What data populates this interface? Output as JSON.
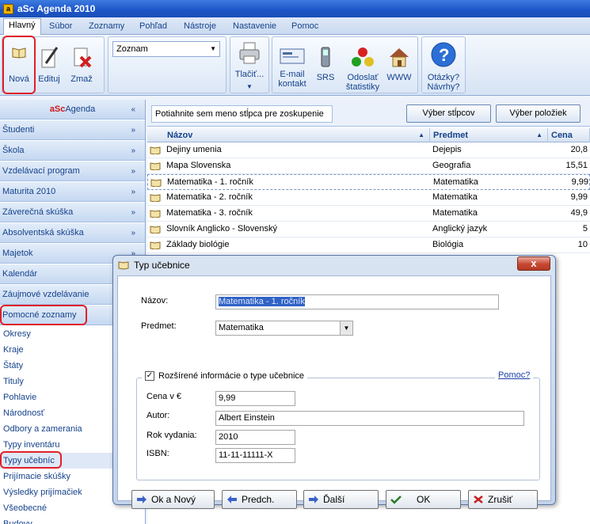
{
  "app": {
    "title": "aSc Agenda 2010"
  },
  "menu": [
    "Hlavný",
    "Súbor",
    "Zoznamy",
    "Pohľad",
    "Nástroje",
    "Nastavenie",
    "Pomoc"
  ],
  "ribbon": {
    "nova": "Nová",
    "edituj": "Edituj",
    "zmaz": "Zmaž",
    "combo": "Zoznam",
    "tlacit": "Tlačiť...",
    "email": "E-mail",
    "kontakt": "kontakt",
    "srs": "SRS",
    "odoslat": "Odoslať",
    "statistiky": "štatistiky",
    "www": "WWW",
    "otazky": "Otázky?",
    "navrhy": "Návrhy?"
  },
  "sidebar": {
    "brand_prefix": "aSc",
    "brand_suffix": "Agenda",
    "sections": [
      "Študenti",
      "Škola",
      "Vzdelávací program",
      "Maturita 2010",
      "Záverečná skúška",
      "Absolventská skúška",
      "Majetok",
      "Kalendár",
      "Záujmové vzdelávanie",
      "Pomocné zoznamy"
    ],
    "items": [
      "Okresy",
      "Kraje",
      "Štáty",
      "Tituly",
      "Pohlavie",
      "Národnosť",
      "Odbory a zamerania",
      "Typy inventáru",
      "Typy učebníc",
      "Prijímacie skúšky",
      "Výsledky prijímačiek",
      "Všeobecné",
      "Budovy"
    ],
    "chev": "»"
  },
  "grid": {
    "group_hint": "Potiahnite sem meno stĺpca pre zoskupenie",
    "btn_columns": "Výber stĺpcov",
    "btn_items": "Výber položiek",
    "col_name": "Názov",
    "col_subject": "Predmet",
    "col_price": "Cena",
    "sort": "▲",
    "rows": [
      {
        "name": "Dejiny umenia",
        "subject": "Dejepis",
        "price": "20,8"
      },
      {
        "name": "Mapa Slovenska",
        "subject": "Geografia",
        "price": "15,51"
      },
      {
        "name": "Matematika - 1. ročník",
        "subject": "Matematika",
        "price": "9,99"
      },
      {
        "name": "Matematika - 2. ročník",
        "subject": "Matematika",
        "price": "9,99"
      },
      {
        "name": "Matematika - 3. ročník",
        "subject": "Matematika",
        "price": "49,9"
      },
      {
        "name": "Slovník Anglicko - Slovenský",
        "subject": "Anglický jazyk",
        "price": "5"
      },
      {
        "name": "Základy biológie",
        "subject": "Biológia",
        "price": "10"
      }
    ]
  },
  "dialog": {
    "title": "Typ učebnice",
    "close": "x",
    "name_label": "Názov:",
    "name_value": "Matematika - 1. ročník",
    "subject_label": "Predmet:",
    "subject_value": "Matematika",
    "extended_label": "Rozšírené informácie o type učebnice",
    "help": "Pomoc?",
    "price_label": "Cena v €",
    "price_value": "9,99",
    "author_label": "Autor:",
    "author_value": "Albert Einstein",
    "year_label": "Rok vydania:",
    "year_value": "2010",
    "isbn_label": "ISBN:",
    "isbn_value": "11-11-11111-X",
    "ok_new": "Ok a Nový",
    "prev": "Predch.",
    "next": "Ďalší",
    "ok": "OK",
    "cancel": "Zrušiť"
  },
  "colors": {
    "accent": "#15428b",
    "title_bar": "#1c55c8",
    "highlight_ring": "#e0202a"
  }
}
